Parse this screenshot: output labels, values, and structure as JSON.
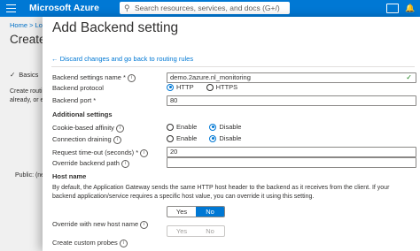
{
  "topbar": {
    "brand": "Microsoft Azure",
    "search_placeholder": "Search resources, services, and docs (G+/)"
  },
  "background": {
    "breadcrumb": "Home > Loa",
    "title": "Create",
    "tab": "Basics",
    "desc_line1": "Create routi",
    "desc_line2": "already, or e",
    "public": "Public: (new"
  },
  "panel": {
    "title": "Add Backend setting",
    "discard_link": "← Discard changes and go back to routing rules",
    "fields": {
      "settings_name_label": "Backend settings name *",
      "settings_name_value": "demo.2azure.nl_monitoring",
      "protocol_label": "Backend protocol",
      "protocol_options": [
        "HTTP",
        "HTTPS"
      ],
      "port_label": "Backend port *",
      "port_value": "80"
    },
    "additional_heading": "Additional settings",
    "additional": {
      "affinity_label": "Cookie-based affinity",
      "draining_label": "Connection draining",
      "enable": "Enable",
      "disable": "Disable",
      "timeout_label": "Request time-out (seconds) *",
      "timeout_value": "20",
      "override_path_label": "Override backend path",
      "override_path_value": ""
    },
    "host_heading": "Host name",
    "host_desc": "By default, the Application Gateway sends the same HTTP host header to the backend as it receives from the client. If your backend application/service requires a specific host value, you can override it using this setting.",
    "host_toggle": {
      "yes": "Yes",
      "no": "No"
    },
    "override_host_label": "Override with new host name",
    "override_toggle": {
      "yes": "Yes",
      "no": "No"
    },
    "probes_label": "Create custom probes"
  }
}
